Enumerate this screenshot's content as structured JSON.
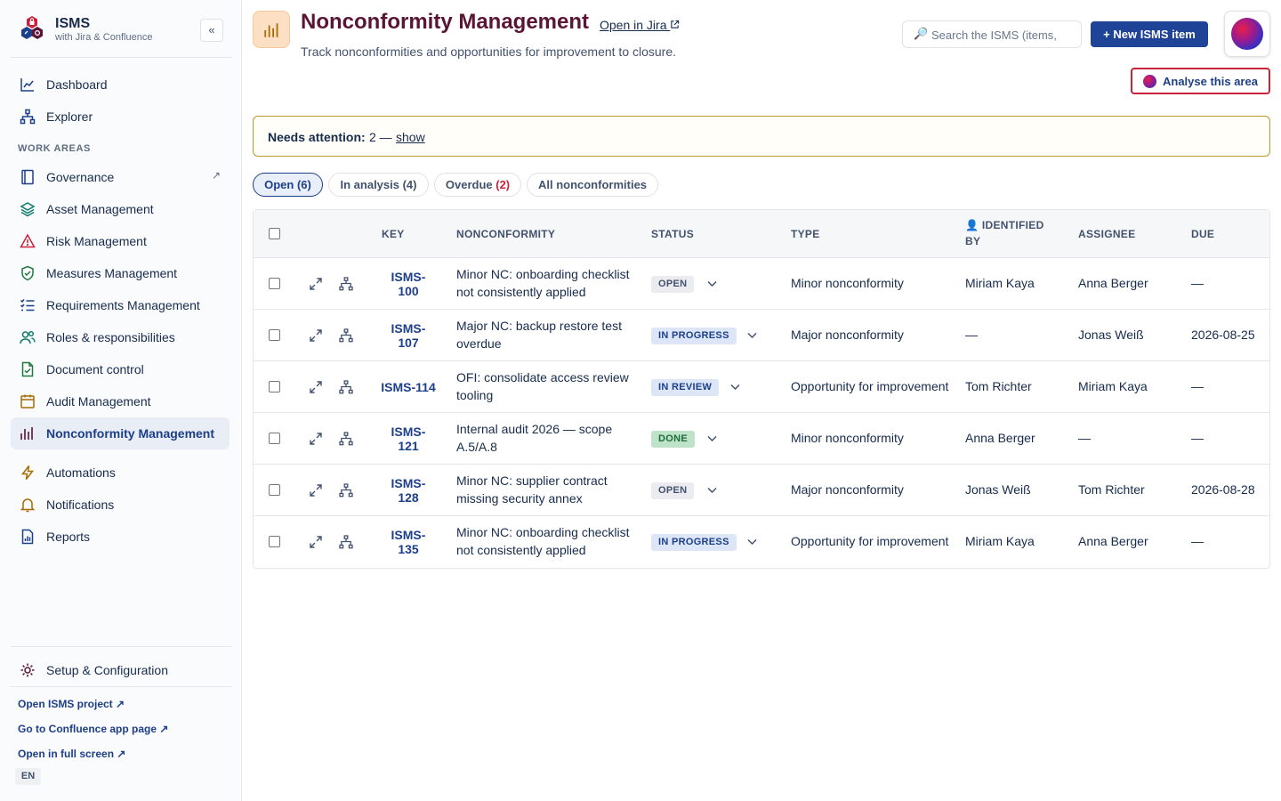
{
  "app": {
    "name": "ISMS",
    "tagline": "with Jira & Confluence",
    "collapse_label": "«"
  },
  "sidebar": {
    "top_items": [
      {
        "label": "Dashboard",
        "icon": "chart-line-icon"
      },
      {
        "label": "Explorer",
        "icon": "hierarchy-icon"
      }
    ],
    "section_label": "WORK AREAS",
    "work_areas": [
      {
        "label": "Governance",
        "icon": "book-icon",
        "external": "↗"
      },
      {
        "label": "Asset Management",
        "icon": "layers-icon"
      },
      {
        "label": "Risk Management",
        "icon": "warning-triangle-icon"
      },
      {
        "label": "Measures Management",
        "icon": "shield-check-icon"
      },
      {
        "label": "Requirements Management",
        "icon": "checklist-icon"
      },
      {
        "label": "Roles & responsibilities",
        "icon": "people-icon"
      },
      {
        "label": "Document control",
        "icon": "document-check-icon"
      },
      {
        "label": "Audit Management",
        "icon": "calendar-icon"
      },
      {
        "label": "Nonconformity Management",
        "icon": "bar-chart-icon",
        "active": true
      }
    ],
    "tools": [
      {
        "label": "Automations",
        "icon": "lightning-icon"
      },
      {
        "label": "Notifications",
        "icon": "bell-icon"
      },
      {
        "label": "Reports",
        "icon": "report-icon"
      }
    ],
    "setup_label": "Setup & Configuration",
    "links": [
      "Open ISMS project ↗",
      "Go to Confluence app page ↗",
      "Open in full screen ↗"
    ],
    "language": "EN"
  },
  "header": {
    "title": "Nonconformity Management",
    "open_jira": "Open in Jira",
    "subtitle": "Track nonconformities and opportunities for improvement to closure.",
    "search_placeholder": "Search the ISMS (items,",
    "new_button": "+ New ISMS item",
    "analyse_button": "Analyse this area"
  },
  "attention": {
    "label": "Needs attention:",
    "count": "2 —",
    "link": "show"
  },
  "tabs": [
    {
      "label": "Open (6)",
      "active": true
    },
    {
      "label": "In analysis (4)"
    },
    {
      "label": "Overdue ",
      "count": "(2)"
    },
    {
      "label": "All nonconformities"
    }
  ],
  "table": {
    "headers": {
      "key": "KEY",
      "nonconformity": "NONCONFORMITY",
      "status": "STATUS",
      "type": "TYPE",
      "identified_by_icon": "👤",
      "identified_by_1": "IDENTIFIED",
      "identified_by_2": "BY",
      "assignee": "ASSIGNEE",
      "due": "DUE"
    },
    "rows": [
      {
        "key1": "ISMS-",
        "key2": "100",
        "summary": "Minor NC: onboarding checklist not consistently applied",
        "status": "OPEN",
        "type": "Minor nonconformity",
        "identified_by": "Miriam Kaya",
        "assignee": "Anna Berger",
        "due": "—"
      },
      {
        "key1": "ISMS-",
        "key2": "107",
        "summary": "Major NC: backup restore test overdue",
        "status": "IN PROGRESS",
        "type": "Major nonconformity",
        "identified_by": "—",
        "assignee": "Jonas Weiß",
        "due": "2026-08-25"
      },
      {
        "key1": "ISMS-114",
        "key2": "",
        "summary": "OFI: consolidate access review tooling",
        "status": "IN REVIEW",
        "type": "Opportunity for improvement",
        "identified_by": "Tom Richter",
        "assignee": "Miriam Kaya",
        "due": "—"
      },
      {
        "key1": "ISMS-",
        "key2": "121",
        "summary": "Internal audit 2026 — scope A.5/A.8",
        "status": "DONE",
        "type": "Minor nonconformity",
        "identified_by": "Anna Berger",
        "assignee": "—",
        "due": "—"
      },
      {
        "key1": "ISMS-",
        "key2": "128",
        "summary": "Minor NC: supplier contract missing security annex",
        "status": "OPEN",
        "type": "Major nonconformity",
        "identified_by": "Jonas Weiß",
        "assignee": "Tom Richter",
        "due": "2026-08-28"
      },
      {
        "key1": "ISMS-",
        "key2": "135",
        "summary": "Minor NC: onboarding checklist not consistently applied",
        "status": "IN PROGRESS",
        "type": "Opportunity for improvement",
        "identified_by": "Miriam Kaya",
        "assignee": "Anna Berger",
        "due": "—"
      }
    ]
  },
  "colors": {
    "brand_blue": "#1f4396",
    "title_maroon": "#5a1535",
    "overdue_red": "#c9223b",
    "attention_border": "#b59b2a"
  }
}
